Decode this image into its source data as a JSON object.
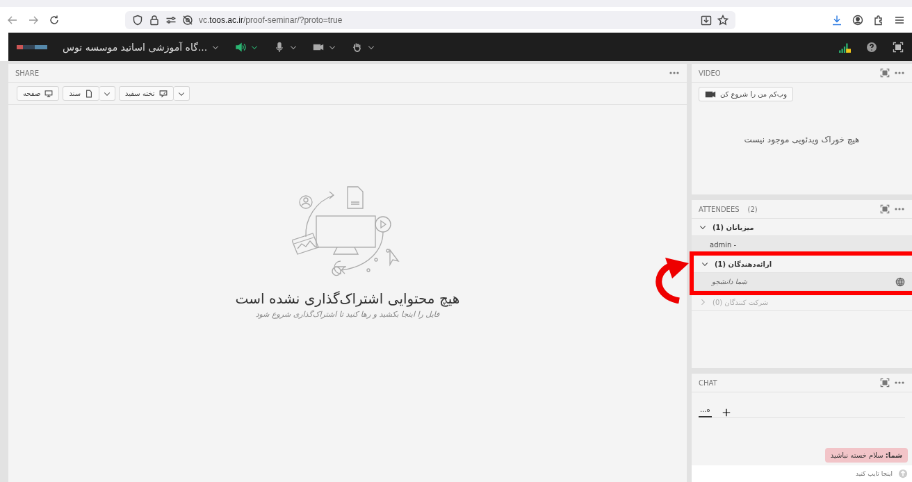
{
  "browser": {
    "url": "vc.**toos.ac.ir**/proof-seminar/?proto=true"
  },
  "app_bar": {
    "meeting_title": "...گاه آموزشی اساتید موسسه توس",
    "controls": [
      {
        "kind": "speaker",
        "active": true
      },
      {
        "kind": "mic",
        "active": false
      },
      {
        "kind": "camera",
        "active": false
      },
      {
        "kind": "hand",
        "active": false
      }
    ]
  },
  "share": {
    "title": "SHARE",
    "buttons": [
      {
        "kind": "whiteboard",
        "label": "تخته سفید",
        "dropdown": true
      },
      {
        "kind": "document",
        "label": "سند",
        "dropdown": true
      },
      {
        "kind": "screen",
        "label": "صفحه",
        "dropdown": false
      }
    ],
    "empty_title": "هیچ محتوایی اشتراک‌گذاری نشده است",
    "empty_hint": "فایل را اینجا بکشید و رها کنید تا اشتراک‌گذاری شروع شود"
  },
  "video": {
    "title": "VIDEO",
    "start_button": "وب‌کم من را شروع کن",
    "empty": "هیچ خوراک ویدئویی موجود نیست"
  },
  "attendees": {
    "title": "ATTENDEES",
    "count": "(2)",
    "groups": [
      {
        "label": "میزبانان (1)",
        "expanded": true,
        "highlighted": false,
        "members": [
          {
            "name": "admin -",
            "self": false
          }
        ]
      },
      {
        "label": "ارائه‌دهندگان (1)",
        "expanded": true,
        "highlighted": true,
        "members": [
          {
            "name": "شما دانشجو",
            "self": true
          }
        ]
      },
      {
        "label": "شرکت کنندگان (0)",
        "expanded": false,
        "highlighted": false
      }
    ]
  },
  "chat": {
    "title": "CHAT",
    "tabs": [
      {
        "label": "...ه",
        "selected": true
      }
    ],
    "messages": [
      {
        "text": "**شما:** سلام خسته نباشید"
      }
    ],
    "placeholder": "اینجا تایپ کنید"
  }
}
